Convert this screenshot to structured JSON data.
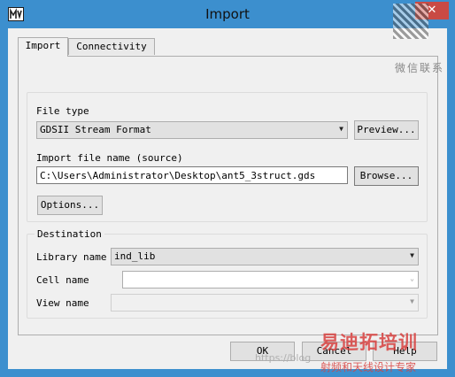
{
  "window": {
    "title": "Import",
    "close_glyph": "✕"
  },
  "tabs": [
    {
      "label": "Import"
    },
    {
      "label": "Connectivity"
    }
  ],
  "file_type": {
    "label": "File type",
    "value": "GDSII Stream Format",
    "preview_button": "Preview..."
  },
  "source": {
    "label": "Import file name (source)",
    "value": "C:\\Users\\Administrator\\Desktop\\ant5_3struct.gds",
    "browse_button": "Browse..."
  },
  "options_button": "Options...",
  "destination": {
    "title": "Destination",
    "library_label": "Library name",
    "library_value": "ind_lib",
    "cell_label": "Cell name",
    "cell_value": "",
    "view_label": "View name",
    "view_value": ""
  },
  "footer": {
    "ok": "OK",
    "cancel": "Cancel",
    "help": "Help"
  },
  "watermark": {
    "top_right": "微信联系",
    "bottom_brand": "易迪拓培训",
    "bottom_sub": "射频和天线设计专家",
    "url": "https://blog"
  },
  "icons": {
    "app": "app-icon",
    "dropdown": "chevron-down-icon"
  }
}
